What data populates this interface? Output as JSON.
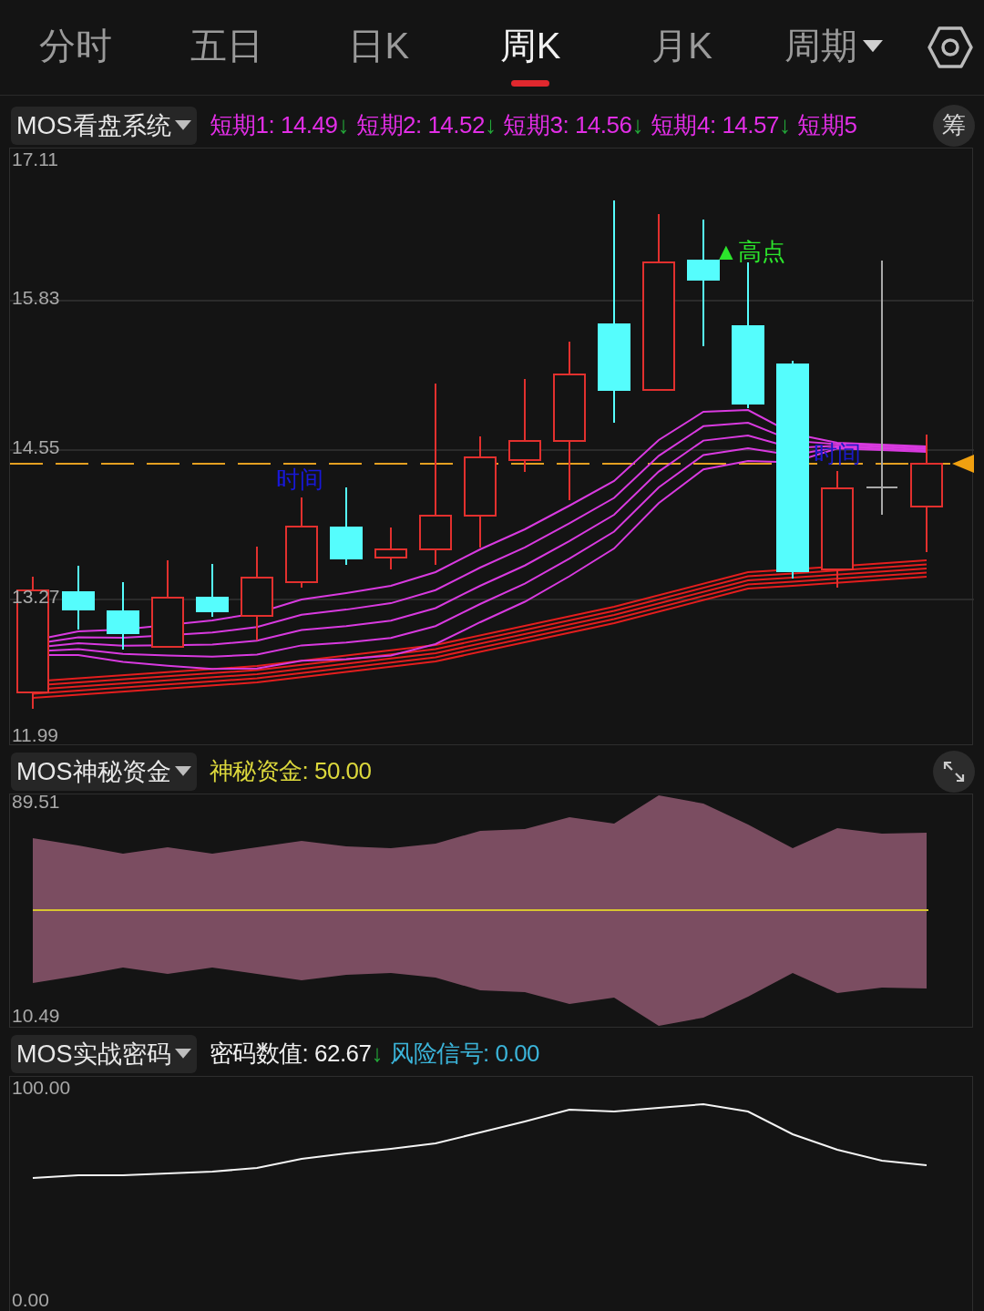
{
  "tabs": [
    {
      "label": "分时",
      "selected": false,
      "kind": "plain"
    },
    {
      "label": "五日",
      "selected": false,
      "kind": "plain"
    },
    {
      "label": "日K",
      "selected": false,
      "kind": "plain"
    },
    {
      "label": "周K",
      "selected": true,
      "kind": "plain"
    },
    {
      "label": "月K",
      "selected": false,
      "kind": "plain"
    },
    {
      "label": "周期",
      "selected": false,
      "kind": "dropdown"
    }
  ],
  "panels": [
    {
      "kind": "kline",
      "selector": "MOS看盘系统",
      "side_button": "筹",
      "readings": [
        {
          "text": "短期1: 14.49",
          "arrow": "↓",
          "color": "#e22ee6"
        },
        {
          "text": "短期2: 14.52",
          "arrow": "↓",
          "color": "#e22ee6"
        },
        {
          "text": "短期3: 14.56",
          "arrow": "↓",
          "color": "#e22ee6"
        },
        {
          "text": "短期4: 14.57",
          "arrow": "↓",
          "color": "#e22ee6"
        },
        {
          "text": "短期5",
          "color": "#e22ee6"
        }
      ],
      "y_ticks": [
        "17.11",
        "15.83",
        "14.55",
        "13.27",
        "11.99"
      ],
      "annotations": [
        {
          "kind": "high",
          "text": "▲高点"
        },
        {
          "kind": "time",
          "text": "时间"
        },
        {
          "kind": "time",
          "text": "时间"
        }
      ]
    },
    {
      "kind": "band",
      "selector": "MOS神秘资金",
      "readings": [
        {
          "text": "神秘资金: 50.00",
          "color": "#dcd83c"
        }
      ],
      "y_ticks": [
        "89.51",
        "10.49"
      ]
    },
    {
      "kind": "line",
      "selector": "MOS实战密码",
      "readings": [
        {
          "text": "密码数值: 62.67",
          "arrow": "↓",
          "color": "#f0f0f0"
        },
        {
          "text": "风险信号: 0.00",
          "color": "#3bb4d9"
        }
      ],
      "y_ticks": [
        "100.00",
        "0.00"
      ]
    }
  ]
}
